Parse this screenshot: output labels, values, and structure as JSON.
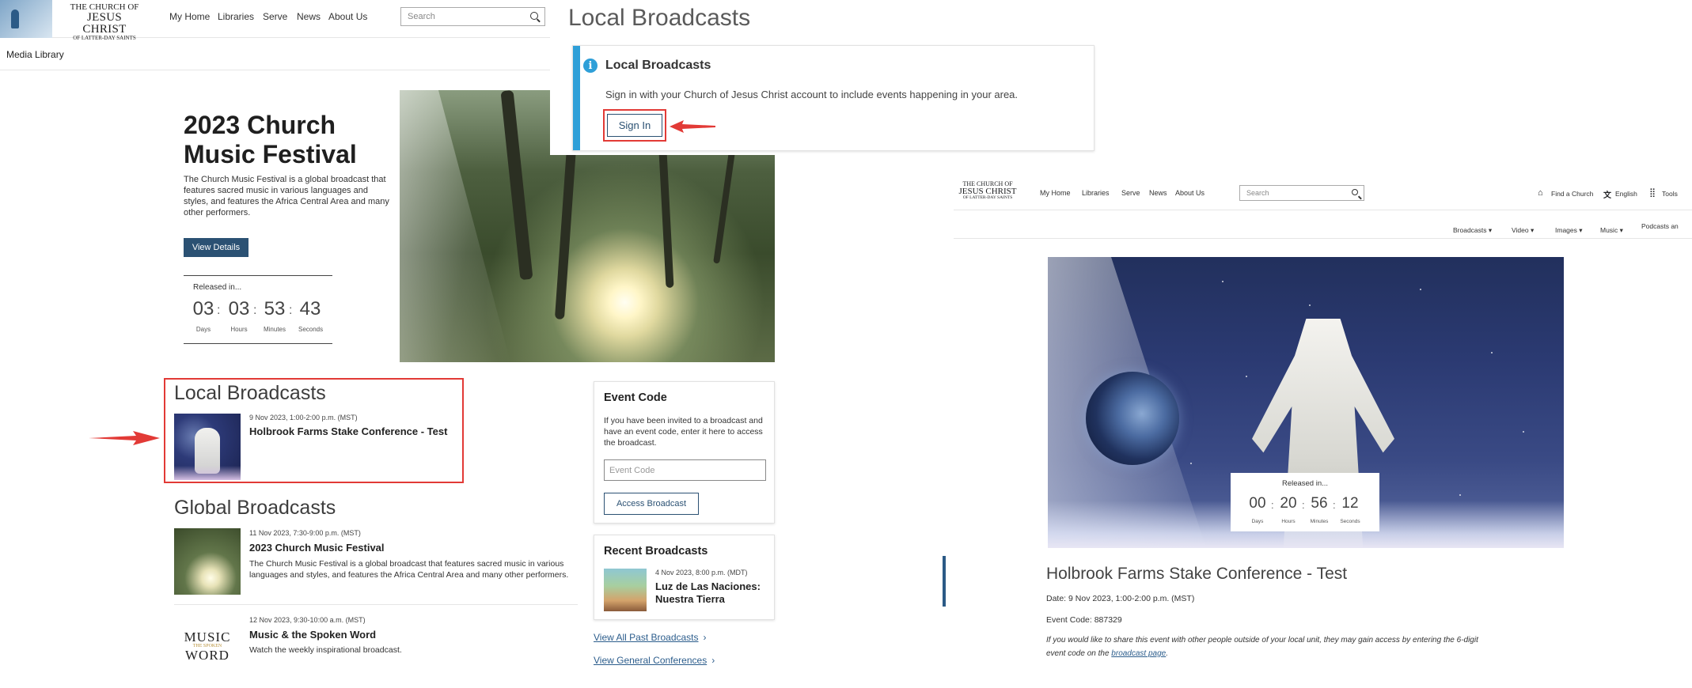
{
  "left": {
    "logo": {
      "line1": "THE CHURCH OF",
      "line2": "JESUS CHRIST",
      "line3": "OF LATTER-DAY SAINTS"
    },
    "nav": [
      "My Home",
      "Libraries",
      "Serve",
      "News",
      "About Us"
    ],
    "search": {
      "placeholder": "Search"
    },
    "breadcrumb": "Media Library",
    "hero": {
      "title_line1": "2023 Church",
      "title_line2": "Music Festival",
      "description": "The Church Music Festival is a global broadcast that features sacred music in various languages and styles, and features the Africa Central Area and many other performers.",
      "button": "View Details",
      "released_label": "Released in...",
      "countdown": [
        {
          "value": "03",
          "unit": "Days"
        },
        {
          "value": "03",
          "unit": "Hours"
        },
        {
          "value": "53",
          "unit": "Minutes"
        },
        {
          "value": "43",
          "unit": "Seconds"
        }
      ]
    },
    "local": {
      "heading": "Local Broadcasts",
      "items": [
        {
          "meta": "9 Nov 2023, 1:00-2:00 p.m. (MST)",
          "title": "Holbrook Farms Stake Conference - Test"
        }
      ]
    },
    "global": {
      "heading": "Global Broadcasts",
      "items": [
        {
          "meta": "11 Nov 2023, 7:30-9:00 p.m. (MST)",
          "title": "2023 Church Music Festival",
          "description": "The Church Music Festival is a global broadcast that features sacred music in various languages and styles, and features the Africa Central Area and many other performers."
        },
        {
          "meta": "12 Nov 2023, 9:30-10:00 a.m. (MST)",
          "title": "Music & the Spoken Word",
          "description": "Watch the weekly inspirational broadcast.",
          "logo": {
            "top": "MUSIC",
            "mid": "THE SPOKEN",
            "bottom": "WORD"
          }
        }
      ]
    },
    "event_code": {
      "title": "Event Code",
      "description": "If you have been invited to a broadcast and have an event code, enter it here to access the broadcast.",
      "input_placeholder": "Event Code",
      "button": "Access Broadcast"
    },
    "recent": {
      "title": "Recent Broadcasts",
      "item": {
        "meta": "4 Nov 2023, 8:00 p.m. (MDT)",
        "title_line1": "Luz de Las Naciones:",
        "title_line2": "Nuestra Tierra"
      }
    },
    "links": [
      "View All Past Broadcasts",
      "View General Conferences"
    ]
  },
  "middle": {
    "page_title": "Local Broadcasts",
    "notice": {
      "title": "Local Broadcasts",
      "message": "Sign in with your Church of Jesus Christ account to include events happening in your area.",
      "button": "Sign In"
    }
  },
  "right": {
    "logo": {
      "line1": "THE CHURCH OF",
      "line2": "JESUS CHRIST",
      "line3": "OF LATTER-DAY SAINTS"
    },
    "nav": [
      "My Home",
      "Libraries",
      "Serve",
      "News",
      "About Us"
    ],
    "search": {
      "placeholder": "Search"
    },
    "utility": [
      "Find a Church",
      "English",
      "Tools"
    ],
    "subnav": [
      "Broadcasts",
      "Video",
      "Images",
      "Music",
      "Podcasts an"
    ],
    "released_label": "Released in...",
    "countdown": [
      {
        "value": "00",
        "unit": "Days"
      },
      {
        "value": "20",
        "unit": "Hours"
      },
      {
        "value": "56",
        "unit": "Minutes"
      },
      {
        "value": "12",
        "unit": "Seconds"
      }
    ],
    "title": "Holbrook Farms Stake Conference - Test",
    "date": "Date: 9 Nov 2023, 1:00-2:00 p.m. (MST)",
    "event_code": "Event Code: 887329",
    "share_text": "If you would like to share this event with other people outside of your local unit, they may gain access by entering the 6-digit event code on the",
    "share_link": "broadcast page",
    "share_end": "."
  },
  "colors": {
    "accent_blue": "#2b5173",
    "info_blue": "#2e9fd8",
    "annotation_red": "#e23a36",
    "link_blue": "#2c5d8c"
  }
}
